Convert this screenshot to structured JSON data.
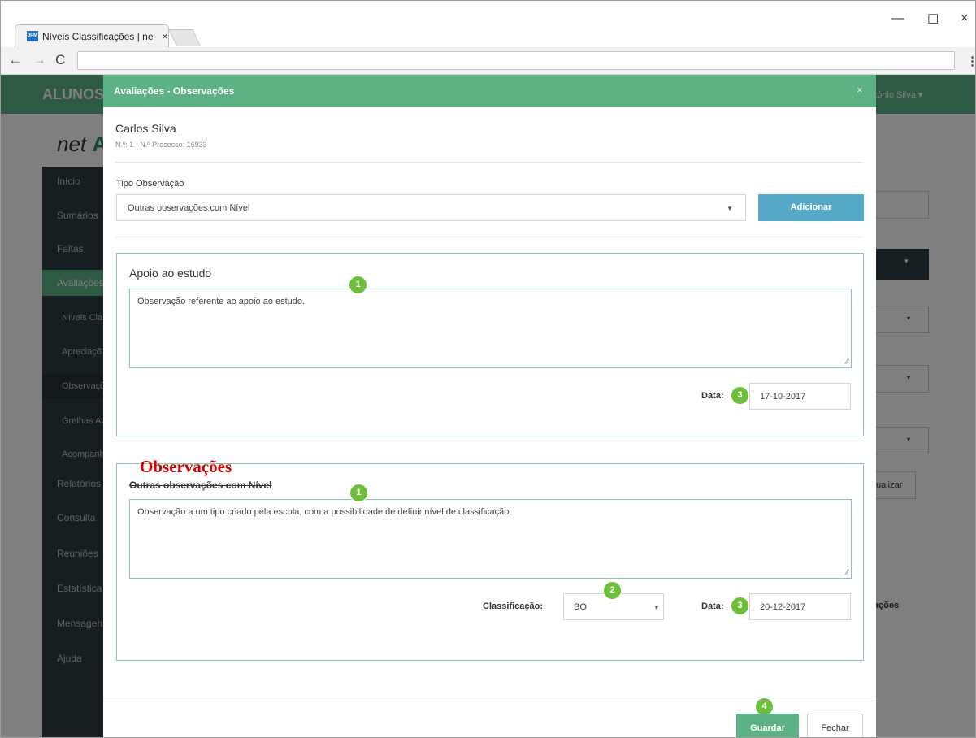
{
  "browser": {
    "tab_title": "Níveis Classificações | ne",
    "tab_close": "×",
    "favicon_text": "JPM",
    "nav_back": "←",
    "nav_forward": "→",
    "nav_reload": "C",
    "menu": "⋮",
    "win_minimize": "—",
    "win_maximize": "☐",
    "win_close": "×"
  },
  "app": {
    "brand": "ALUNOS",
    "user": "ntónio Silva ▾",
    "logo_prefix": "net",
    "logo_suffix": "A",
    "sidebar": [
      {
        "label": "Início"
      },
      {
        "label": "Sumários"
      },
      {
        "label": "Faltas"
      },
      {
        "label": "Avaliações"
      },
      {
        "label": "Níveis Clas"
      },
      {
        "label": "Apreciaçõ"
      },
      {
        "label": "Observaçõ"
      },
      {
        "label": "Grelhas Av"
      },
      {
        "label": "Acompanh"
      },
      {
        "label": "Relatórios"
      },
      {
        "label": "Consulta"
      },
      {
        "label": "Reuniões"
      },
      {
        "label": "Estatística"
      },
      {
        "label": "Mensagens"
      },
      {
        "label": "Ajuda"
      }
    ],
    "right_button": "ualizar",
    "right_header": "ações"
  },
  "modal": {
    "title": "Avaliações - Observações",
    "close": "×",
    "student_name": "Carlos Silva",
    "student_meta": "N.º: 1 - N.º Processo: 16933",
    "tipo_label": "Tipo Observação",
    "tipo_value": "Outras observações com Nível",
    "add_button": "Adicionar",
    "panels": [
      {
        "title": "Apoio ao estudo",
        "text": "Observação referente ao apoio ao estudo.",
        "date_label": "Data:",
        "date": "17-10-2017"
      },
      {
        "title": "Outras observações com Nível",
        "text": "Observação a um tipo criado pela escola, com a possibilidade de definir nível de classificação.",
        "classificacao_label": "Classificação:",
        "classificacao_value": "BO",
        "date_label": "Data:",
        "date": "20-12-2017"
      }
    ],
    "save_button": "Guardar",
    "close_button": "Fechar"
  },
  "annotations": {
    "heading": "Observações",
    "badges": [
      "1",
      "3",
      "1",
      "2",
      "3",
      "4"
    ]
  },
  "colors": {
    "primary": "#5cb284",
    "info": "#56a9c6",
    "badge": "#6cbf3a",
    "annotation": "#d40000"
  }
}
